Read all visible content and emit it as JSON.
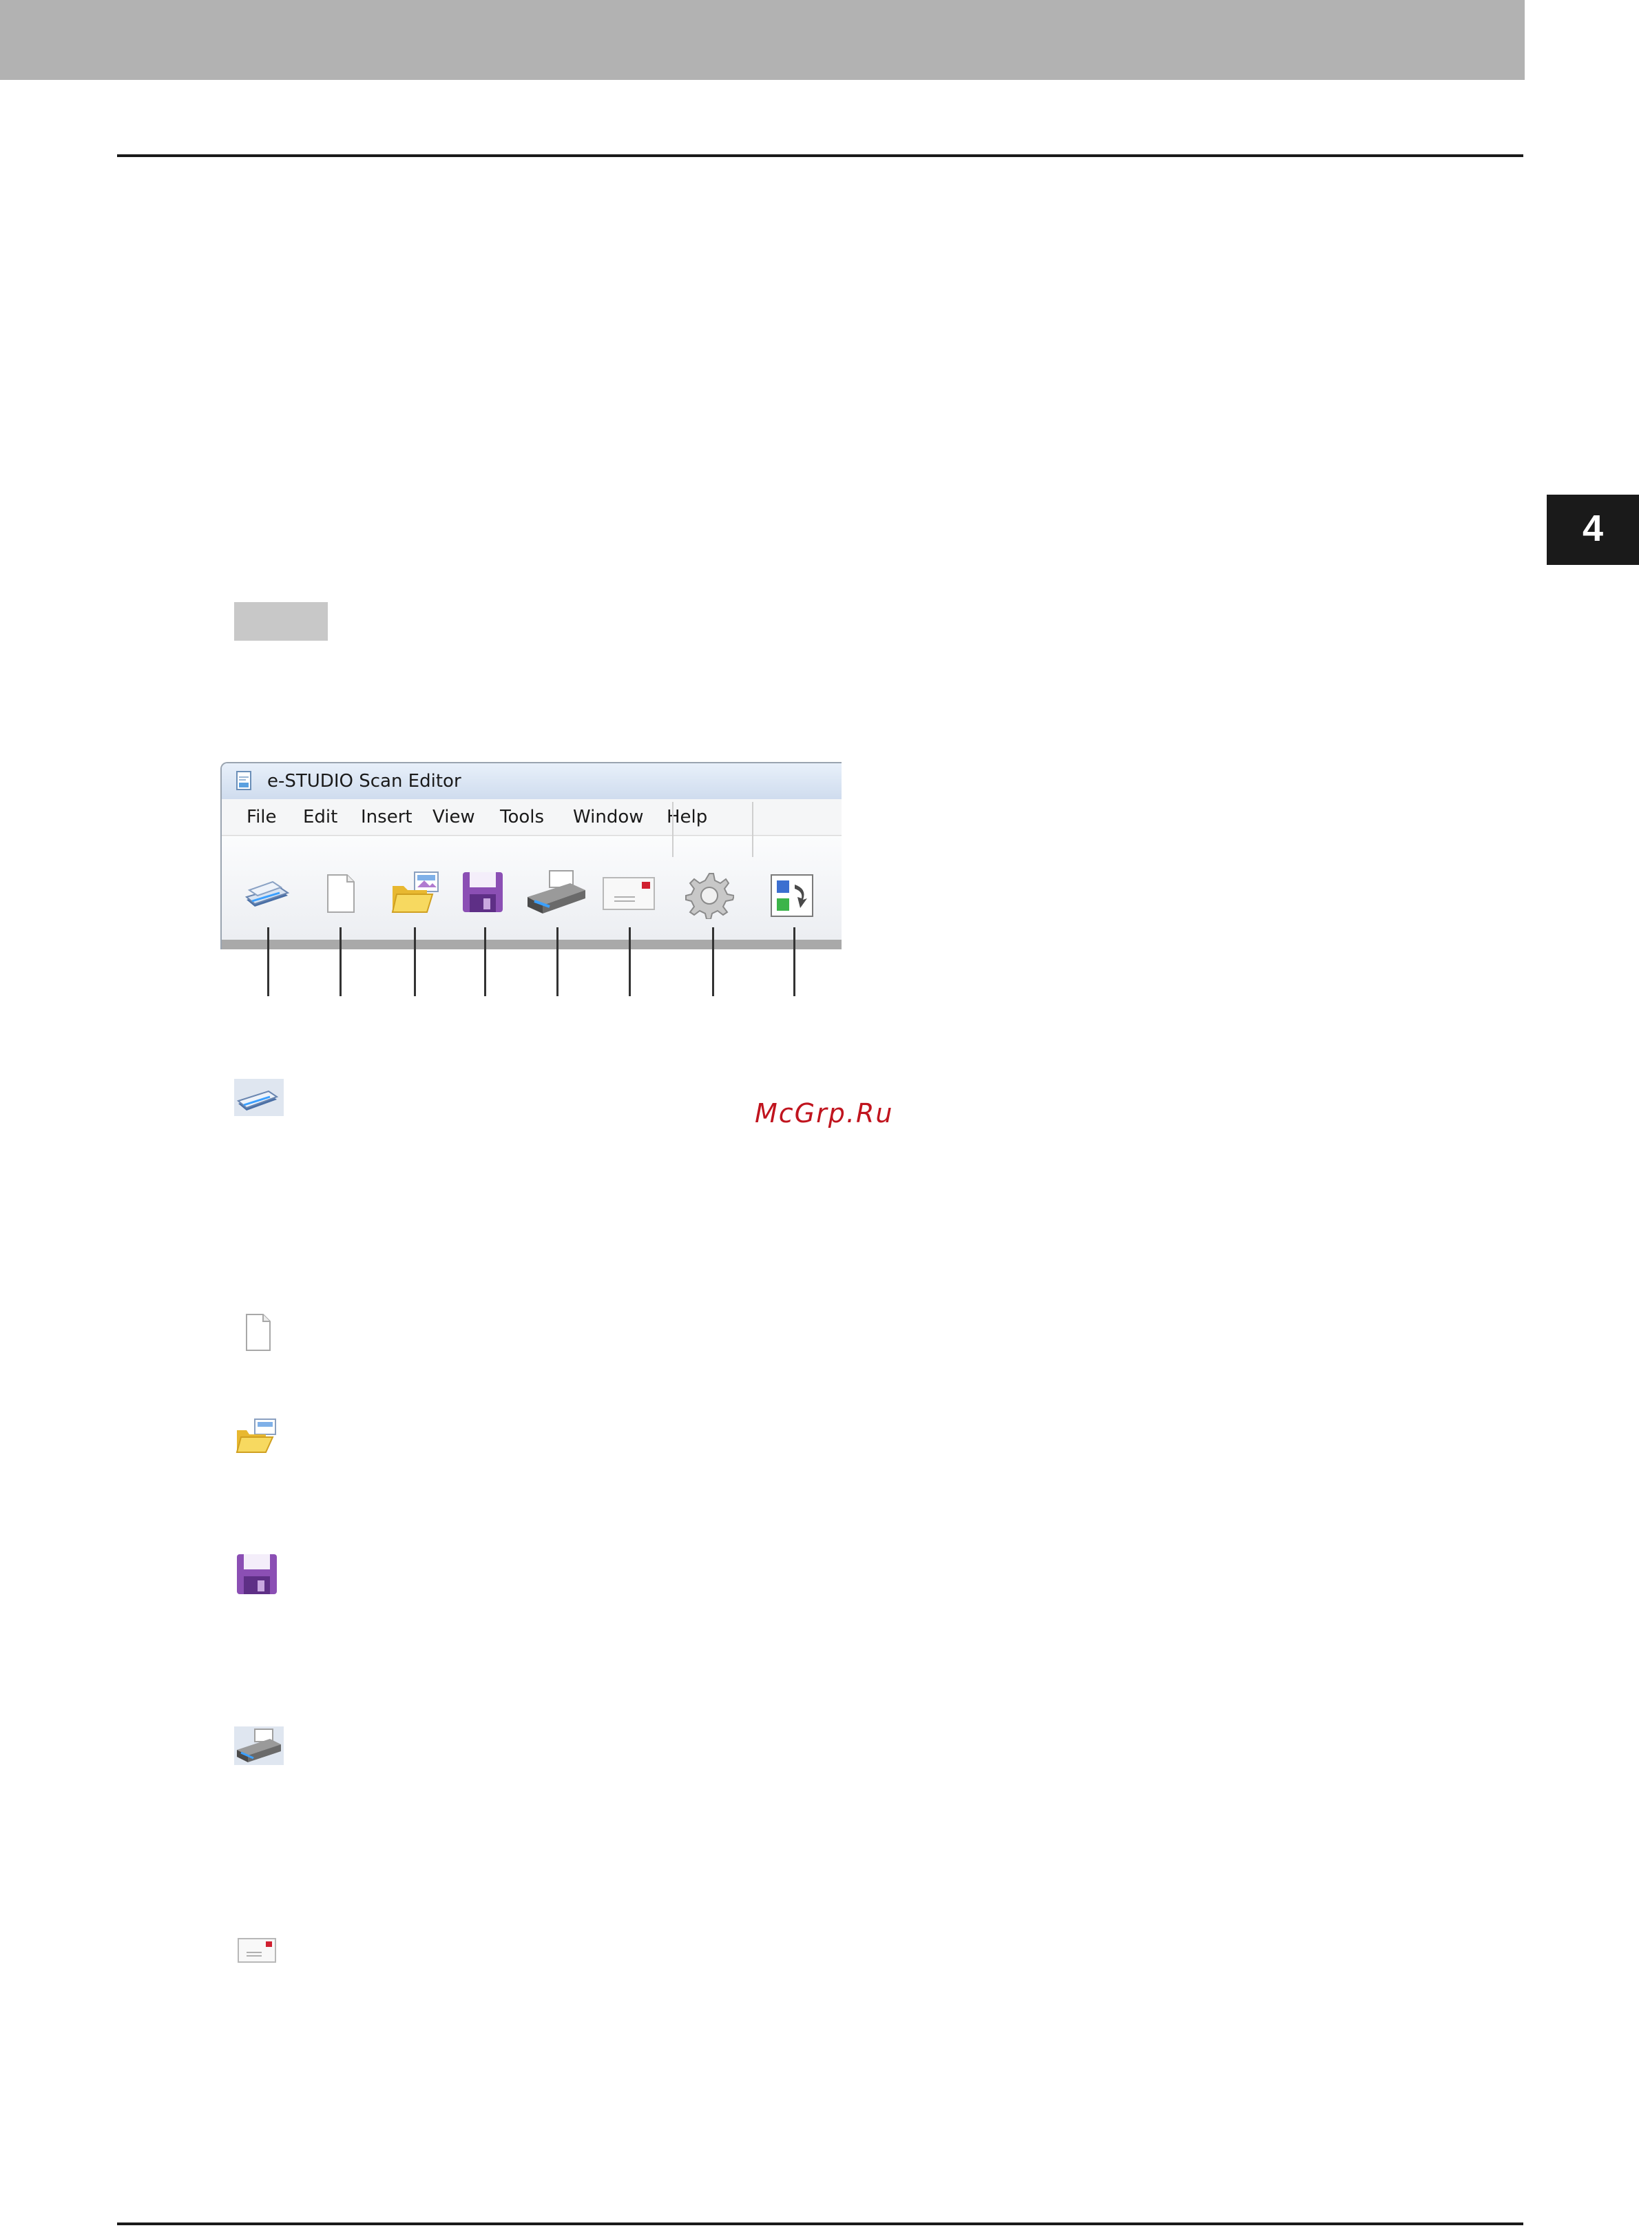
{
  "chapter": {
    "number": "4"
  },
  "app_window": {
    "title": "e-STUDIO Scan Editor",
    "menu": [
      "File",
      "Edit",
      "Insert",
      "View",
      "Tools",
      "Window",
      "Help"
    ],
    "toolbar_buttons": [
      {
        "icon": "scanner-icon"
      },
      {
        "icon": "new-document-icon"
      },
      {
        "icon": "open-folder-icon"
      },
      {
        "icon": "save-floppy-icon"
      },
      {
        "icon": "printer-icon"
      },
      {
        "icon": "email-envelope-icon"
      },
      {
        "icon": "settings-gear-icon"
      },
      {
        "icon": "swap-layout-icon"
      }
    ]
  },
  "watermark": "McGrp.Ru",
  "icon_list": [
    {
      "icon": "scanner-icon"
    },
    {
      "icon": "new-document-icon"
    },
    {
      "icon": "open-folder-icon"
    },
    {
      "icon": "save-floppy-icon"
    },
    {
      "icon": "printer-icon"
    },
    {
      "icon": "email-envelope-icon"
    }
  ],
  "colors": {
    "header_band": "#b2b2b2",
    "chapter_tab": "#1a1a1a",
    "watermark": "#c0141e",
    "floppy": "#8b4fb4",
    "folder": "#f2cf4a"
  }
}
